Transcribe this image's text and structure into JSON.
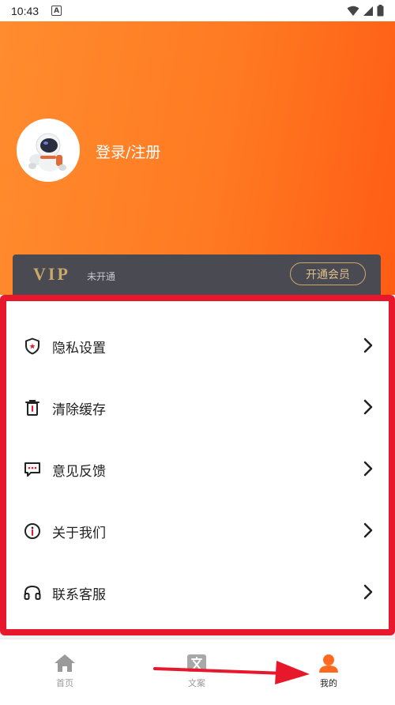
{
  "status_bar": {
    "time": "10:43",
    "notif_letter": "A"
  },
  "profile": {
    "login_label": "登录/注册"
  },
  "vip": {
    "logo": "VIP",
    "status": "未开通",
    "button_label": "开通会员",
    "gold_color": "#c9a86a"
  },
  "menu": {
    "items": [
      {
        "label": "隐私设置",
        "icon": "shield-icon"
      },
      {
        "label": "清除缓存",
        "icon": "trash-icon"
      },
      {
        "label": "意见反馈",
        "icon": "feedback-icon"
      },
      {
        "label": "关于我们",
        "icon": "info-icon"
      },
      {
        "label": "联系客服",
        "icon": "headset-icon"
      }
    ]
  },
  "nav": {
    "tabs": [
      {
        "label": "首页",
        "icon": "home-icon",
        "active": false
      },
      {
        "label": "文案",
        "icon": "text-icon",
        "active": false
      },
      {
        "label": "我的",
        "icon": "profile-icon",
        "active": true
      }
    ]
  },
  "colors": {
    "accent": "#ff7a22",
    "highlight_border": "#e8182c",
    "vip_bar": "#4a4a52"
  }
}
